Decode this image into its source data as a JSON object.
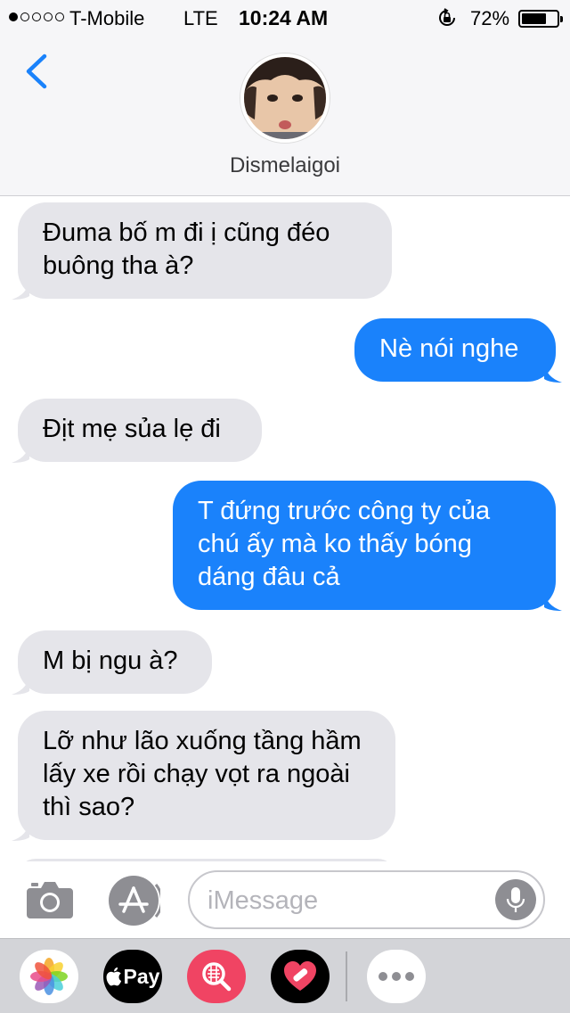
{
  "status_bar": {
    "carrier": "T-Mobile",
    "network": "LTE",
    "time": "10:24 AM",
    "battery_percent": "72%",
    "battery_level": 0.72,
    "signal_bars_filled": 1,
    "signal_bars_total": 5
  },
  "header": {
    "contact_name": "Dismelaigoi",
    "back_icon": "chevron-left-icon",
    "avatar": "contact-avatar-photo"
  },
  "messages": [
    {
      "direction": "incoming",
      "text": "Đuma bố m đi ị cũng đéo buông tha à?"
    },
    {
      "direction": "outgoing",
      "text": "Nè nói nghe"
    },
    {
      "direction": "incoming",
      "text": "Địt mẹ sủa lẹ đi"
    },
    {
      "direction": "outgoing",
      "text": "T đứng trước công ty của chú ấy mà ko thấy bóng dáng đâu cả"
    },
    {
      "direction": "incoming",
      "text": "M bị ngu à?"
    },
    {
      "direction": "incoming",
      "text": "Lỡ như lão xuống tầng hầm lấy xe rồi chạy vọt ra ngoài thì sao?"
    }
  ],
  "input_bar": {
    "placeholder": "iMessage",
    "value": "",
    "camera_icon": "camera-icon",
    "appstore_icon": "app-store-icon",
    "mic_icon": "microphone-icon"
  },
  "app_drawer": {
    "apple_pay_label": "Pay",
    "apps": [
      "photos-icon",
      "apple-pay-icon",
      "image-search-icon",
      "heart-sticker-icon",
      "more-icon"
    ]
  },
  "colors": {
    "outgoing_bubble": "#1a82fb",
    "incoming_bubble": "#e5e5ea",
    "accent": "#1a82fb",
    "header_bg": "#f6f6f8",
    "drawer_bg": "#d3d4d8"
  }
}
